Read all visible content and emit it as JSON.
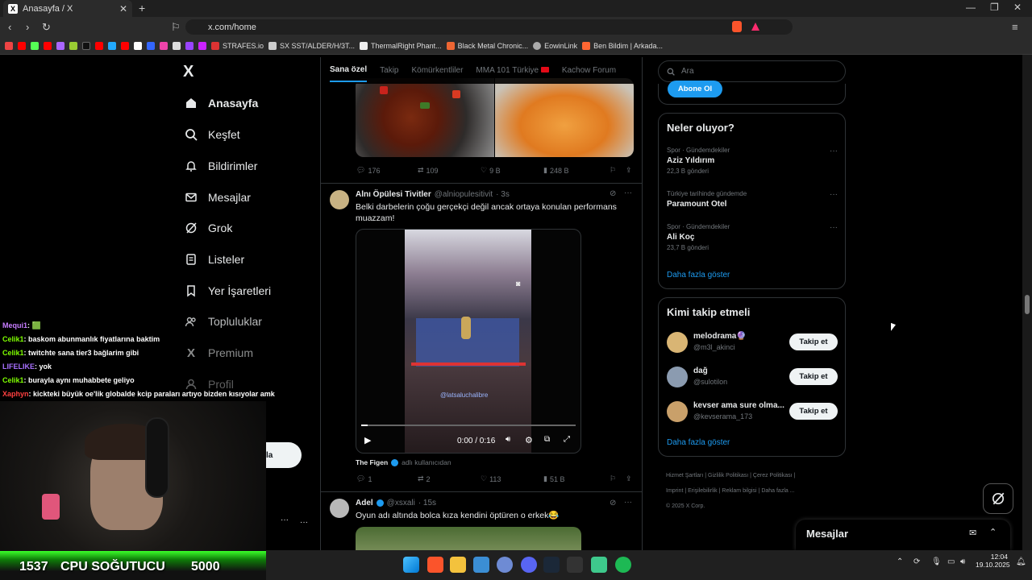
{
  "browser": {
    "tab_title": "Anasayfa / X",
    "url": "x.com/home",
    "bookmarks": [
      "STRAFES.io",
      "SX SST/ALDER/H/3T...",
      "ThermalRight Phant...",
      "Black Metal Chronic...",
      "EowinLink",
      "Ben Bildim | Arkada..."
    ]
  },
  "sidebar": {
    "logo": "X",
    "items": [
      {
        "label": "Anasayfa",
        "icon": "home-icon"
      },
      {
        "label": "Keşfet",
        "icon": "search-icon"
      },
      {
        "label": "Bildirimler",
        "icon": "bell-icon"
      },
      {
        "label": "Mesajlar",
        "icon": "mail-icon"
      },
      {
        "label": "Grok",
        "icon": "grok-icon"
      },
      {
        "label": "Listeler",
        "icon": "list-icon"
      },
      {
        "label": "Yer İşaretleri",
        "icon": "bookmark-icon"
      },
      {
        "label": "Topluluklar",
        "icon": "people-icon"
      },
      {
        "label": "Premium",
        "icon": "x-icon"
      },
      {
        "label": "Profil",
        "icon": "user-icon"
      }
    ],
    "post_button_partial": "la"
  },
  "feed": {
    "tabs": [
      "Sana özel",
      "Takip",
      "Kömürkentliler",
      "MMA 101 Türkiye",
      "Kachow Forum"
    ],
    "tweet1_stats": {
      "replies": "176",
      "retweets": "109",
      "likes": "9 B",
      "views": "248 B"
    },
    "tweet2": {
      "name": "Alnı Öpülesi Tivitler",
      "handle": "@alniopulesitivit",
      "time": "· 3s",
      "text": "Belki darbelerin çoğu gerçekçi değil ancak ortaya konulan performans muazzam!",
      "video_time": "0:00 / 0:16",
      "video_watermark": "@latsaluchalibre",
      "attribution_name": "The Figen",
      "attribution_suffix": "adlı kullanıcıdan",
      "stats": {
        "replies": "1",
        "retweets": "2",
        "likes": "113",
        "views": "51 B"
      }
    },
    "tweet3": {
      "name": "Adel",
      "handle": "@xsxali",
      "time": "· 15s",
      "text": "Oyun adı altında bolca kıza kendini öptüren o erkek😂"
    }
  },
  "right": {
    "search_placeholder": "Ara",
    "subscribe_button": "Abone Ol",
    "trends_title": "Neler oluyor?",
    "trends": [
      {
        "meta": "Spor · Gündemdekiler",
        "title": "Aziz Yıldırım",
        "count": "22,3 B gönderi"
      },
      {
        "meta": "Türkiye tarihinde gündemde",
        "title": "Paramount Otel",
        "count": ""
      },
      {
        "meta": "Spor · Gündemdekiler",
        "title": "Ali Koç",
        "count": "23,7 B gönderi"
      }
    ],
    "trends_more": "Daha fazla göster",
    "who_to_follow_title": "Kimi takip etmeli",
    "suggestions": [
      {
        "name": "melodrama🔮",
        "handle": "@m3l_akinci",
        "button": "Takip et"
      },
      {
        "name": "dağ",
        "handle": "@sulotilon",
        "button": "Takip et"
      },
      {
        "name": "kevser ama sure olma...",
        "handle": "@kevserama_173",
        "button": "Takip et"
      }
    ],
    "follow_more": "Daha fazla göster",
    "footer": [
      "Hizmet Şartları",
      "Gizlilik Politikası",
      "Çerez Politikası",
      "Imprint",
      "Erişilebilirlik",
      "Reklam bilgisi",
      "Daha fazla ...",
      "© 2025 X Corp."
    ],
    "messages_dock": "Mesajlar"
  },
  "stream_overlay": {
    "chat": [
      {
        "user": "Mequi1",
        "text": ": 🟩",
        "color": "#c77dff"
      },
      {
        "user": "Celik1",
        "text": ": baskom abunmanlık fiyatlarına baktim",
        "color": "#7fff00"
      },
      {
        "user": "Celik1",
        "text": ": twitchte sana tier3 bağlarim gibi",
        "color": "#7fff00"
      },
      {
        "user": "LIFELIKE",
        "text": ": yok",
        "color": "#a970ff"
      },
      {
        "user": "Celik1",
        "text": ": burayla aynı muhabbete geliyo",
        "color": "#7fff00"
      },
      {
        "user": "Xaphyn",
        "text": ": kickteki büyük oe'lik globalde kcip paraları artıyo bizden kısıyolar amk",
        "color": "#ff4040"
      }
    ],
    "banner_count": "1537",
    "banner_text": "CPU SOĞUTUCU",
    "banner_goal": "5000"
  },
  "taskbar": {
    "time": "12:04",
    "date": "19.10.2025"
  }
}
